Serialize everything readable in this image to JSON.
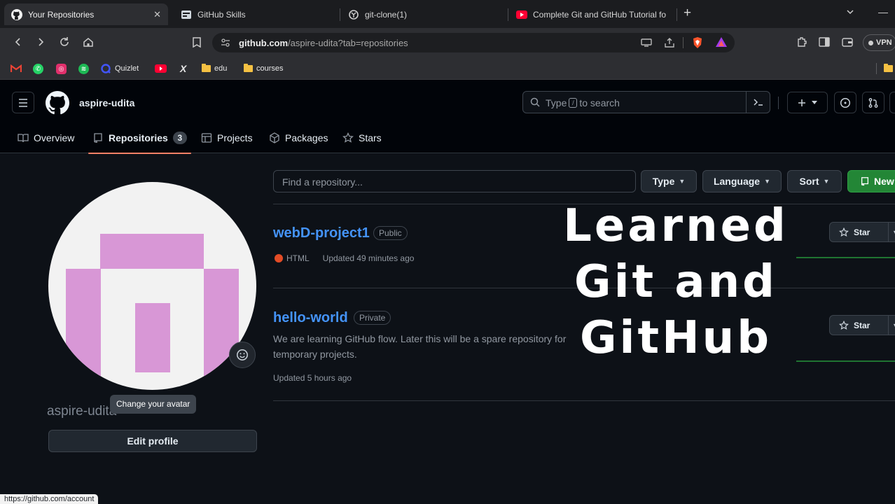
{
  "browser": {
    "tabs": [
      {
        "title": "Your Repositories",
        "icon": "github-icon",
        "active": true
      },
      {
        "title": "GitHub Skills",
        "icon": "github-skills-icon",
        "active": false
      },
      {
        "title": "git-clone(1)",
        "icon": "globe-icon",
        "active": false
      },
      {
        "title": "Complete Git and GitHub Tutorial fo",
        "icon": "youtube-icon",
        "active": false
      }
    ],
    "url_host": "github.com",
    "url_path": "/aspire-udita?tab=repositories",
    "vpn_label": "VPN",
    "bookmarks": [
      {
        "label": "",
        "icon": "gmail-icon"
      },
      {
        "label": "",
        "icon": "whatsapp-icon"
      },
      {
        "label": "",
        "icon": "instagram-icon"
      },
      {
        "label": "",
        "icon": "spotify-icon"
      },
      {
        "label": "Quizlet",
        "icon": "quizlet-icon"
      },
      {
        "label": "",
        "icon": "youtube-icon"
      },
      {
        "label": "",
        "icon": "x-icon"
      },
      {
        "label": "edu",
        "icon": "folder-icon"
      },
      {
        "label": "courses",
        "icon": "folder-icon"
      }
    ]
  },
  "header": {
    "username": "aspire-udita",
    "search_placeholder_before": "Type",
    "search_key": "/",
    "search_placeholder_after": "to search"
  },
  "nav": {
    "tabs": [
      {
        "label": "Overview",
        "icon": "book-icon"
      },
      {
        "label": "Repositories",
        "icon": "repo-icon",
        "count": "3",
        "selected": true
      },
      {
        "label": "Projects",
        "icon": "table-icon"
      },
      {
        "label": "Packages",
        "icon": "package-icon"
      },
      {
        "label": "Stars",
        "icon": "star-icon"
      }
    ]
  },
  "profile": {
    "display_name": "aspire-udita",
    "avatar_tooltip": "Change your avatar",
    "edit_button": "Edit profile"
  },
  "repo_filters": {
    "search_placeholder": "Find a repository...",
    "type_label": "Type",
    "language_label": "Language",
    "sort_label": "Sort",
    "new_label": "New"
  },
  "repos": [
    {
      "name": "webD-project1",
      "visibility": "Public",
      "description": "",
      "language": "HTML",
      "language_color": "#e34c26",
      "updated": "Updated 49 minutes ago",
      "star_label": "Star"
    },
    {
      "name": "hello-world",
      "visibility": "Private",
      "description": "We are learning GitHub flow. Later this will be a spare repository for temporary projects.",
      "language": "",
      "updated": "Updated 5 hours ago",
      "star_label": "Star"
    }
  ],
  "overlay": {
    "lines": [
      "Learned",
      "Git and",
      "GitHub"
    ]
  },
  "status_bar": {
    "link": "https://github.com/account"
  },
  "colors": {
    "page_bg": "#0d1117",
    "header_bg": "#010409",
    "link_blue": "#4493f8",
    "accent_underline": "#f78166",
    "new_button_green": "#238636",
    "avatar_pink": "#d897d6"
  }
}
